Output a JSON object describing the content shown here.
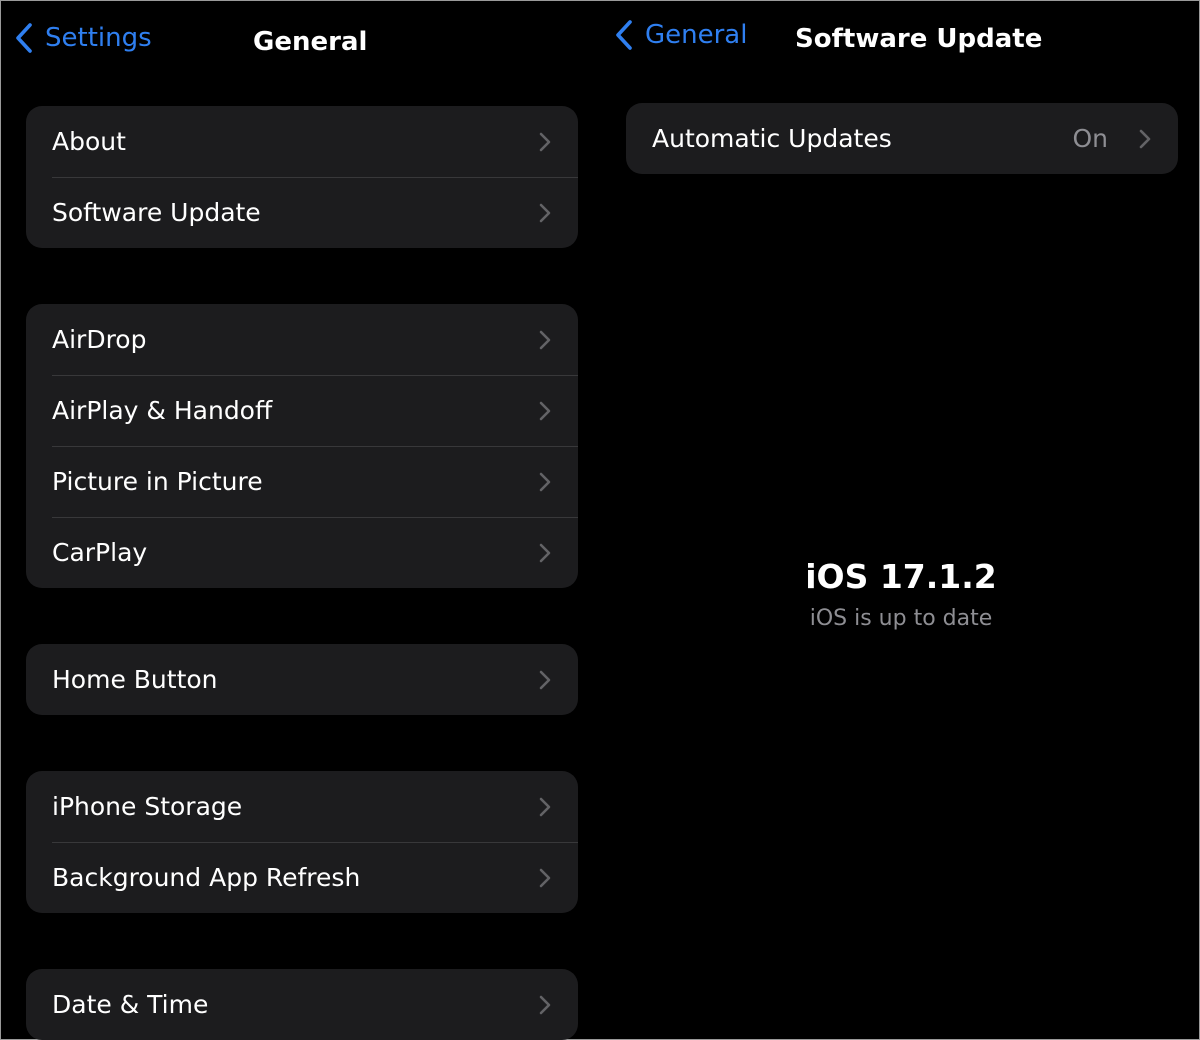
{
  "general": {
    "back_label": "Settings",
    "title": "General",
    "groups": [
      [
        "About",
        "Software Update"
      ],
      [
        "AirDrop",
        "AirPlay & Handoff",
        "Picture in Picture",
        "CarPlay"
      ],
      [
        "Home Button"
      ],
      [
        "iPhone Storage",
        "Background App Refresh"
      ],
      [
        "Date & Time"
      ]
    ]
  },
  "software_update": {
    "back_label": "General",
    "title": "Software Update",
    "automatic_updates_label": "Automatic Updates",
    "automatic_updates_value": "On",
    "version": "iOS 17.1.2",
    "status": "iOS is up to date"
  },
  "colors": {
    "accent": "#2f7ff0",
    "background": "#000000",
    "cell": "#1c1c1e",
    "secondary_text": "#8e8e93"
  }
}
